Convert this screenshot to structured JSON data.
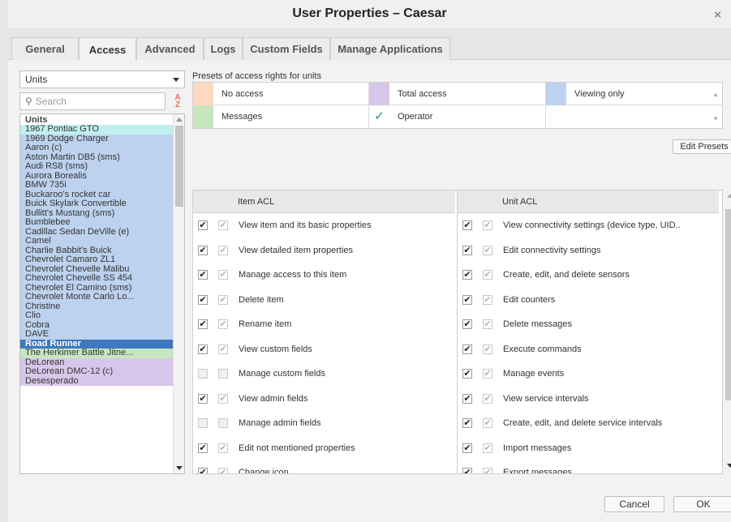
{
  "window": {
    "title": "User Properties – Caesar",
    "close": "×"
  },
  "tabs": [
    {
      "label": "General"
    },
    {
      "label": "Access"
    },
    {
      "label": "Advanced"
    },
    {
      "label": "Logs"
    },
    {
      "label": "Custom Fields"
    },
    {
      "label": "Manage Applications"
    }
  ],
  "left": {
    "type_select": "Units",
    "search_placeholder": "Search",
    "sort_icon": "sort-az-icon",
    "list_header": "Units",
    "units": [
      {
        "name": "1967 Pontiac GTO",
        "color": "cyan"
      },
      {
        "name": "1969 Dodge Charger",
        "color": "blue"
      },
      {
        "name": "Aaron (c)",
        "color": "blue"
      },
      {
        "name": "Aston Martin DB5 (sms)",
        "color": "blue"
      },
      {
        "name": "Audi RS8 (sms)",
        "color": "blue"
      },
      {
        "name": "Aurora Borealis",
        "color": "blue"
      },
      {
        "name": "BMW 735i",
        "color": "blue"
      },
      {
        "name": "Buckaroo's rocket car",
        "color": "blue"
      },
      {
        "name": "Buick Skylark Convertible",
        "color": "blue"
      },
      {
        "name": "Bullitt's Mustang (sms)",
        "color": "blue"
      },
      {
        "name": "Bumblebee",
        "color": "blue"
      },
      {
        "name": "Cadillac Sedan DeVille (e)",
        "color": "blue"
      },
      {
        "name": "Camel",
        "color": "blue"
      },
      {
        "name": "Charlie Babbit's Buick",
        "color": "blue"
      },
      {
        "name": "Chevrolet Camaro ZL1",
        "color": "blue"
      },
      {
        "name": "Chevrolet Chevelle Malibu",
        "color": "blue"
      },
      {
        "name": "Chevrolet Chevelle SS 454",
        "color": "blue"
      },
      {
        "name": "Chevrolet El Camino (sms)",
        "color": "blue"
      },
      {
        "name": "Chevrolet Monte Carlo Lo...",
        "color": "blue"
      },
      {
        "name": "Christine",
        "color": "blue"
      },
      {
        "name": "Clio",
        "color": "blue"
      },
      {
        "name": "Cobra",
        "color": "blue"
      },
      {
        "name": "DAVE",
        "color": "blue"
      },
      {
        "name": "Road Runner",
        "color": "selected"
      },
      {
        "name": "The Herkimer Battle Jitne...",
        "color": "green"
      },
      {
        "name": "DeLorean",
        "color": "purple"
      },
      {
        "name": "DeLorean DMC-12 (c)",
        "color": "purple"
      },
      {
        "name": "Desesperado",
        "color": "purple"
      }
    ]
  },
  "presets": {
    "label": "Presets of access rights for units",
    "items": [
      {
        "name": "No access",
        "color": "#fcd9bf",
        "check": ""
      },
      {
        "name": "Total access",
        "color": "#d8c6ea",
        "check": ""
      },
      {
        "name": "Viewing  only",
        "color": "#bdd2ee",
        "check": ""
      },
      {
        "name": "Messages",
        "color": "#c6e6bf",
        "check": ""
      },
      {
        "name": "Operator",
        "color": "#ffffff",
        "check": "✓"
      }
    ],
    "edit_button": "Edit Presets"
  },
  "item_acl": {
    "header": "Item ACL",
    "rows": [
      {
        "label": "View item and its basic properties",
        "checked": true
      },
      {
        "label": "View detailed item properties",
        "checked": true
      },
      {
        "label": "Manage access to this item",
        "checked": true
      },
      {
        "label": "Delete item",
        "checked": true
      },
      {
        "label": "Rename item",
        "checked": true
      },
      {
        "label": "View custom fields",
        "checked": true
      },
      {
        "label": "Manage custom fields",
        "checked": false
      },
      {
        "label": "View admin fields",
        "checked": true
      },
      {
        "label": "Manage admin fields",
        "checked": false
      },
      {
        "label": "Edit not mentioned properties",
        "checked": true
      },
      {
        "label": "Change icon",
        "checked": true
      }
    ]
  },
  "unit_acl": {
    "header": "Unit ACL",
    "rows": [
      {
        "label": "View connectivity settings (device type, UID..",
        "checked": true
      },
      {
        "label": "Edit connectivity settings",
        "checked": true
      },
      {
        "label": "Create, edit, and delete sensors",
        "checked": true
      },
      {
        "label": "Edit counters",
        "checked": true
      },
      {
        "label": "Delete messages",
        "checked": true
      },
      {
        "label": "Execute commands",
        "checked": true
      },
      {
        "label": "Manage events",
        "checked": true
      },
      {
        "label": "View service intervals",
        "checked": true
      },
      {
        "label": "Create, edit, and delete service intervals",
        "checked": true
      },
      {
        "label": "Import messages",
        "checked": true
      },
      {
        "label": "Export messages",
        "checked": true
      }
    ]
  },
  "footer": {
    "cancel": "Cancel",
    "ok": "OK"
  }
}
